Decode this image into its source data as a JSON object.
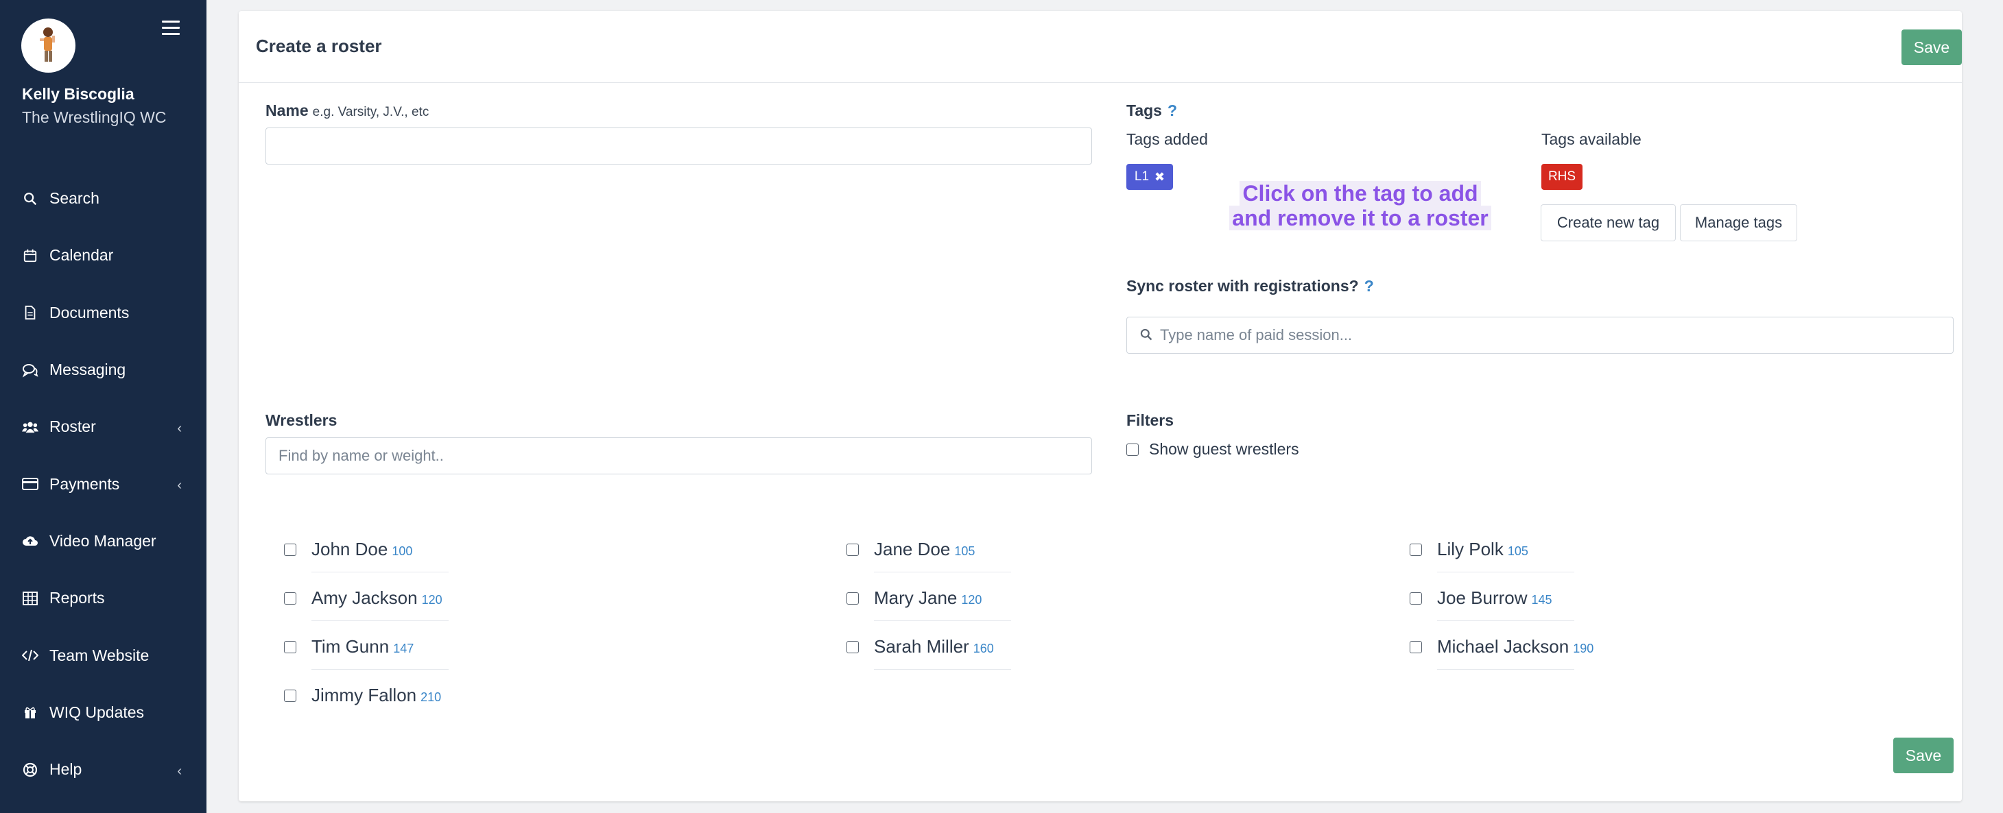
{
  "sidebar": {
    "user_name": "Kelly Biscoglia",
    "team_name": "The WrestlingIQ WC",
    "items": [
      {
        "label": "Search",
        "icon": "search-icon",
        "has_chevron": false
      },
      {
        "label": "Calendar",
        "icon": "calendar-icon",
        "has_chevron": false
      },
      {
        "label": "Documents",
        "icon": "document-icon",
        "has_chevron": false
      },
      {
        "label": "Messaging",
        "icon": "chat-icon",
        "has_chevron": false
      },
      {
        "label": "Roster",
        "icon": "users-icon",
        "has_chevron": true
      },
      {
        "label": "Payments",
        "icon": "credit-card-icon",
        "has_chevron": true
      },
      {
        "label": "Video Manager",
        "icon": "cloud-upload-icon",
        "has_chevron": false
      },
      {
        "label": "Reports",
        "icon": "table-icon",
        "has_chevron": false
      },
      {
        "label": "Team Website",
        "icon": "code-icon",
        "has_chevron": false
      },
      {
        "label": "WIQ Updates",
        "icon": "gift-icon",
        "has_chevron": false
      },
      {
        "label": "Help",
        "icon": "lifebuoy-icon",
        "has_chevron": true
      }
    ]
  },
  "header": {
    "title": "Create a roster",
    "save_label": "Save"
  },
  "name_field": {
    "label": "Name",
    "hint": "e.g. Varsity, J.V., etc",
    "value": ""
  },
  "tags": {
    "label": "Tags",
    "help": "?",
    "added_label": "Tags added",
    "available_label": "Tags available",
    "added": [
      {
        "name": "L1",
        "remove": "✖"
      }
    ],
    "available": [
      {
        "name": "RHS"
      }
    ],
    "create_label": "Create new tag",
    "manage_label": "Manage tags",
    "callout_line1": "Click on the tag to add",
    "callout_line2": "and remove it to a roster"
  },
  "sync": {
    "label": "Sync roster with registrations?",
    "help": "?",
    "placeholder": "Type name of paid session..."
  },
  "wrestlers": {
    "label": "Wrestlers",
    "placeholder": "Find by name or weight..",
    "list": [
      {
        "name": "John Doe",
        "weight": "100"
      },
      {
        "name": "Jane Doe",
        "weight": "105"
      },
      {
        "name": "Lily Polk",
        "weight": "105"
      },
      {
        "name": "Amy Jackson",
        "weight": "120"
      },
      {
        "name": "Mary Jane",
        "weight": "120"
      },
      {
        "name": "Joe Burrow",
        "weight": "145"
      },
      {
        "name": "Tim Gunn",
        "weight": "147"
      },
      {
        "name": "Sarah Miller",
        "weight": "160"
      },
      {
        "name": "Michael Jackson",
        "weight": "190"
      },
      {
        "name": "Jimmy Fallon",
        "weight": "210"
      }
    ]
  },
  "filters": {
    "label": "Filters",
    "guest_label": "Show guest wrestlers"
  },
  "footer": {
    "save_label": "Save"
  },
  "colors": {
    "sidebar_bg": "#182a45",
    "save_green": "#56a57f",
    "tag_added": "#4f5bd5",
    "tag_available": "#d62a1f",
    "callout": "#8a53e6",
    "weight_blue": "#3a86c8"
  }
}
